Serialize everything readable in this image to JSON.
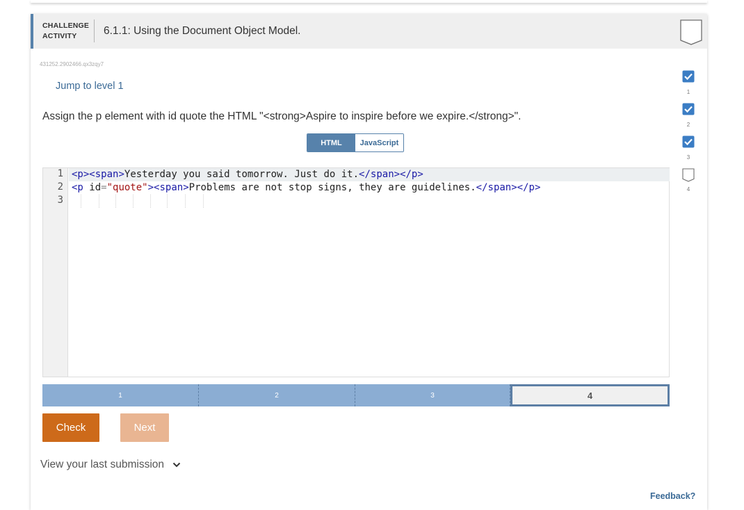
{
  "header": {
    "activity_type_line1": "CHALLENGE",
    "activity_type_line2": "ACTIVITY",
    "title": "6.1.1: Using the Document Object Model."
  },
  "activity_id": "431252.2902466.qx3zqy7",
  "jump_link": "Jump to level 1",
  "instructions": "Assign the p element with id quote the HTML \"<strong>Aspire to inspire before we expire.</strong>\".",
  "tabs": [
    {
      "label": "HTML",
      "active": true
    },
    {
      "label": "JavaScript",
      "active": false
    }
  ],
  "editor": {
    "line_numbers": [
      "1",
      "2",
      "3"
    ],
    "lines": [
      "<p><span>Yesterday you said tomorrow. Just do it.</span></p>",
      "<p id=\"quote\"><span>Problems are not stop signs, they are guidelines.</span></p>",
      ""
    ]
  },
  "levels": [
    {
      "label": "1",
      "completed": true
    },
    {
      "label": "2",
      "completed": true
    },
    {
      "label": "3",
      "completed": true
    },
    {
      "label": "4",
      "completed": false,
      "current": true
    }
  ],
  "buttons": {
    "check": "Check",
    "next": "Next"
  },
  "view_submission": "View your last submission",
  "feedback": "Feedback?",
  "progress": [
    {
      "label": "1",
      "done": true
    },
    {
      "label": "2",
      "done": true
    },
    {
      "label": "3",
      "done": true
    },
    {
      "label": "4",
      "done": false
    }
  ],
  "colors": {
    "accent": "#5782ab",
    "check_button": "#cd6a1a",
    "next_button_disabled": "#e9b592",
    "level_completed": "#8badd3",
    "link": "#3b6a96"
  }
}
